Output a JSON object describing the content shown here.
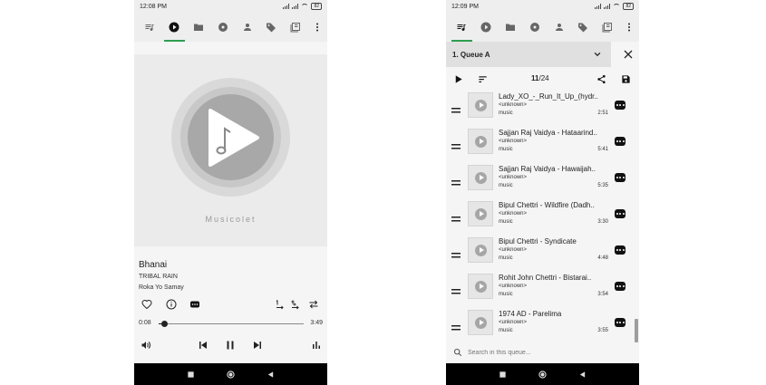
{
  "left": {
    "status": {
      "time": "12:08 PM",
      "battery": "82"
    },
    "tabs": [
      {
        "icon": "queue-music-icon"
      },
      {
        "icon": "play-circle-icon",
        "active": true
      },
      {
        "icon": "folder-icon"
      },
      {
        "icon": "album-icon"
      },
      {
        "icon": "person-icon"
      },
      {
        "icon": "tag-icon"
      },
      {
        "icon": "playlist-icon"
      }
    ],
    "brand": "Musicolet",
    "track": {
      "title": "Bhanai",
      "artist": "TRIBAL RAIN",
      "album": "Roka Yo Samay"
    },
    "position": "0:08",
    "duration": "3:49",
    "progress": 0.035
  },
  "right": {
    "status": {
      "time": "12:09 PM",
      "battery": "82"
    },
    "queue": {
      "name": "1. Queue A",
      "current": "11",
      "total": "/24",
      "items": [
        {
          "title": "Lady_XO_-_Run_It_Up_(hydr..",
          "artist": "<unknown>",
          "album": "music",
          "duration": "2:51"
        },
        {
          "title": "Sajjan Raj Vaidya - Hataarind..",
          "artist": "<unknown>",
          "album": "music",
          "duration": "5:41"
        },
        {
          "title": "Sajjan Raj Vaidya - Hawaijah..",
          "artist": "<unknown>",
          "album": "music",
          "duration": "5:35"
        },
        {
          "title": "Bipul Chettri - Wildfire (Dadh..",
          "artist": "<unknown>",
          "album": "music",
          "duration": "3:30"
        },
        {
          "title": "Bipul Chettri - Syndicate",
          "artist": "<unknown>",
          "album": "music",
          "duration": "4:48"
        },
        {
          "title": "Rohit John Chettri - Bistarai..",
          "artist": "<unknown>",
          "album": "music",
          "duration": "3:54"
        },
        {
          "title": "1974 AD - Parelima",
          "artist": "<unknown>",
          "album": "music",
          "duration": "3:55"
        }
      ],
      "search_placeholder": "Search in this queue..."
    }
  },
  "colors": {
    "accent": "#2e9e4f",
    "navbar": "#000000",
    "toolbar": "#eeeeee"
  }
}
